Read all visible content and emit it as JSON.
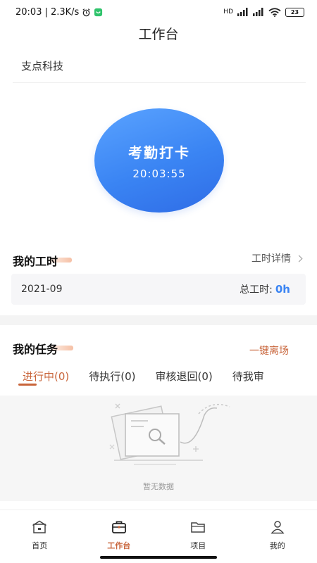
{
  "status_bar": {
    "time": "20:03",
    "speed": "| 2.3K/s",
    "network_label": "HD",
    "battery_level": "23"
  },
  "header": {
    "title": "工作台"
  },
  "company": {
    "name": "支点科技"
  },
  "punch": {
    "label": "考勤打卡",
    "time": "20:03:55"
  },
  "hours": {
    "section_title": "我的工时",
    "details_link": "工时详情",
    "month": "2021-09",
    "total_label": "总工时:",
    "total_value": "0h"
  },
  "tasks": {
    "section_title": "我的任务",
    "leave_button": "一键离场",
    "tabs": [
      {
        "label": "进行中(0)",
        "active": true
      },
      {
        "label": "待执行(0)",
        "active": false
      },
      {
        "label": "审核退回(0)",
        "active": false
      },
      {
        "label": "待我审",
        "active": false
      }
    ],
    "empty_text": "暂无数据"
  },
  "bottom_nav": [
    {
      "label": "首页",
      "icon": "home-icon",
      "active": false
    },
    {
      "label": "工作台",
      "icon": "briefcase-icon",
      "active": true
    },
    {
      "label": "项目",
      "icon": "folder-icon",
      "active": false
    },
    {
      "label": "我的",
      "icon": "person-icon",
      "active": false
    }
  ],
  "colors": {
    "accent": "#c8643a",
    "primary_blue": "#3a84f3"
  }
}
